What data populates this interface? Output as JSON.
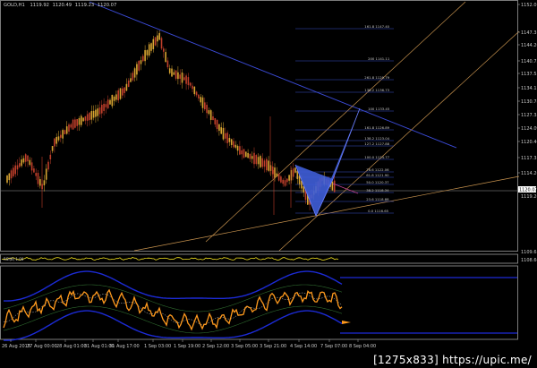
{
  "header": {
    "symbol": "GOLD,H1",
    "quote_values": [
      "1119.92",
      "1120.49",
      "1119.23",
      "1120.07"
    ]
  },
  "price_axis": {
    "labels": [
      "1152.01",
      "1147.31",
      "1144.20",
      "1140.75",
      "1137.55",
      "1134.11",
      "1130.78",
      "1127.35",
      "1124.09",
      "1120.46",
      "1117.31",
      "1114.26",
      "1111.01",
      "1109.6",
      "1108.66"
    ],
    "current_price": "1120.07",
    "current_price_alt": "1119.26"
  },
  "time_axis": {
    "labels": [
      "26 Aug 2015",
      "27 Aug 00:00",
      "28 Aug 01:00",
      "31 Aug 01:00",
      "31 Aug 17:00",
      "1 Sep 03:00",
      "1 Sep 19:00",
      "2 Sep 12:00",
      "3 Sep 05:00",
      "3 Sep 21:00",
      "4 Sep 14:00",
      "7 Sep 07:00",
      "8 Sep 00:00",
      "8 Sep 04:00"
    ]
  },
  "fibonacci": [
    {
      "label": "161.8 1147.40"
    },
    {
      "label": "200 1141.11"
    },
    {
      "label": "261.8 1129.79"
    },
    {
      "label": "138.2 1136.73"
    },
    {
      "label": "100 1133.45"
    },
    {
      "label": "161.8 1126.89"
    },
    {
      "label": "138.2 1123.04"
    },
    {
      "label": "127.2 1127.88"
    },
    {
      "label": "100.0 1124.77"
    },
    {
      "label": "78.6 1122.06"
    },
    {
      "label": "61.8 1121.90"
    },
    {
      "label": "50.0 1120.37"
    },
    {
      "label": "38.2 1118.34"
    },
    {
      "label": "23.6 1118.88"
    },
    {
      "label": "0.0 1116.65"
    }
  ],
  "indicator_panel": {
    "label": "RSI(8) 1.00"
  },
  "watermark": "[1275x833] https://upic.me/",
  "colors": {
    "background": "#000000",
    "bull_candle": "#d9a531",
    "bear_candle": "#c03f2b",
    "trendline": "#3b4bd8",
    "channel": "#c8934e",
    "pattern": "#3f5ed8",
    "oscillator_main": "#ff9a1e",
    "oscillator_band": "#1c2bd6",
    "strength_line": "#f0e020"
  },
  "chart_data": {
    "type": "candlestick",
    "instrument": "GOLD",
    "timeframe": "H1",
    "ylim": [
      1108.66,
      1152.01
    ],
    "key_levels": {
      "swing_high": 1147.31,
      "swing_low": 1116.65,
      "last_price": 1120.07
    },
    "ohlc_header": {
      "open": 1119.92,
      "high": 1120.49,
      "low": 1119.23,
      "close": 1120.07
    }
  }
}
